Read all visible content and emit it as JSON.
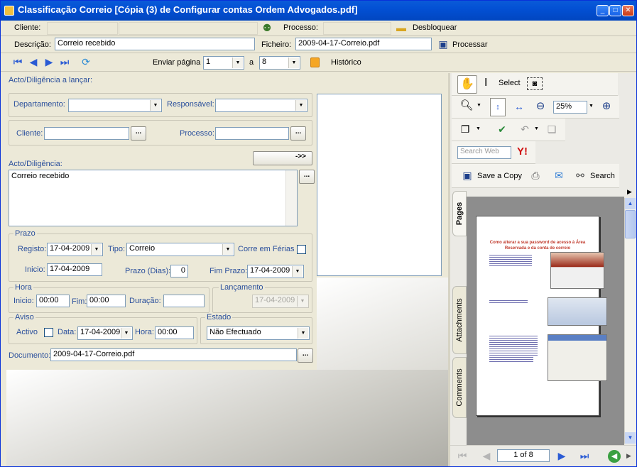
{
  "window": {
    "title": "Classificação Correio [Cópia (3) de Configurar contas Ordem Advogados.pdf]"
  },
  "toprow": {
    "cliente_label": "Cliente:",
    "processo_label": "Processo:",
    "desbloquear_label": "Desbloquear"
  },
  "descrow": {
    "descricao_label": "Descrição:",
    "descricao_value": "Correio recebido",
    "ficheiro_label": "Ficheiro:",
    "ficheiro_value": "2009-04-17-Correio.pdf",
    "processar_label": "Processar"
  },
  "navrow": {
    "enviar_label": "Enviar página",
    "from_value": "1",
    "a_label": "a",
    "to_value": "8",
    "historico_label": "Histórico"
  },
  "form": {
    "acto_lancar_label": "Acto/Diligência a lançar:",
    "departamento_label": "Departamento:",
    "responsavel_label": "Responsável:",
    "cliente_label": "Cliente:",
    "processo_label": "Processo:",
    "move_button_label": "->>",
    "acto_label": "Acto/Diligência:",
    "acto_value": "Correio recebido",
    "dots": "...",
    "prazo": {
      "title": "Prazo",
      "registo_label": "Registo:",
      "registo_value": "17-04-2009",
      "tipo_label": "Tipo:",
      "tipo_value": "Correio",
      "corre_ferias_label": "Corre em Férias",
      "inicio_label": "Inicio:",
      "inicio_value": "17-04-2009",
      "prazo_dias_label": "Prazo (Dias):",
      "prazo_dias_value": "0",
      "fim_prazo_label": "Fim Prazo:",
      "fim_prazo_value": "17-04-2009"
    },
    "hora": {
      "title": "Hora",
      "inicio_label": "Inicio:",
      "inicio_value": "00:00",
      "fim_label": "Fim:",
      "fim_value": "00:00",
      "duracao_label": "Duração:"
    },
    "lancamento": {
      "title": "Lançamento",
      "value": "17-04-2009"
    },
    "aviso": {
      "title": "Aviso",
      "activo_label": "Activo",
      "data_label": "Data:",
      "data_value": "17-04-2009",
      "hora_label": "Hora:",
      "hora_value": "00:00"
    },
    "estado": {
      "title": "Estado",
      "value": "Não Efectuado"
    },
    "documento_label": "Documento:",
    "documento_value": "2009-04-17-Correio.pdf"
  },
  "pdf": {
    "select_label": "Select",
    "zoom_value": "25%",
    "search_web_placeholder": "Search Web",
    "save_copy_label": "Save a Copy",
    "search_label": "Search",
    "tabs": [
      "Pages",
      "Attachments",
      "Comments"
    ],
    "page_indicator": "1 of 8",
    "doc_title_line1": "Como alterar a sua password de acesso à Área",
    "doc_title_line2": "Reservada e da conta de correio"
  },
  "colors": {
    "titlebar": "#0a5bd8",
    "label_blue": "#2a4f9c",
    "doc_title": "#c0392b"
  }
}
